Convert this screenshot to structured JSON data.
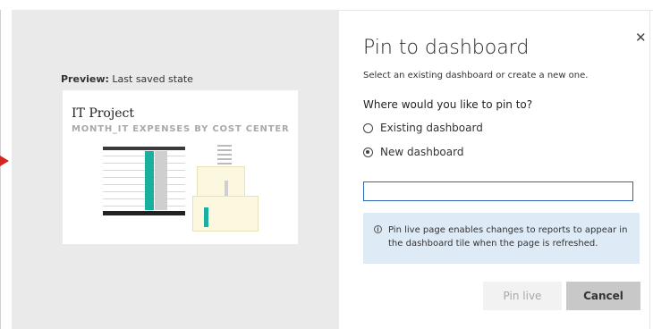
{
  "preview": {
    "label_bold": "Preview:",
    "label_rest": " Last saved state",
    "card_title": "IT Project",
    "card_subtitle": "MONTH_IT EXPENSES BY COST CENTER"
  },
  "dialog": {
    "close_glyph": "✕",
    "title": "Pin to dashboard",
    "subtitle": "Select an existing dashboard or create a new one.",
    "question": "Where would you like to pin to?",
    "options": [
      {
        "label": "Existing dashboard",
        "checked": false
      },
      {
        "label": "New dashboard",
        "checked": true
      }
    ],
    "name_input": {
      "value": "",
      "placeholder": ""
    },
    "info": {
      "icon": "info-icon",
      "glyph": "i",
      "text": "Pin live page enables changes to reports to appear in the dashboard tile when the page is refreshed."
    },
    "buttons": {
      "pin_live": "Pin live",
      "cancel": "Cancel"
    }
  },
  "colors": {
    "accent_input_border": "#2c63b7",
    "info_background": "#deeaf6",
    "arrow": "#d5251f",
    "teal": "#1ab0a0"
  }
}
